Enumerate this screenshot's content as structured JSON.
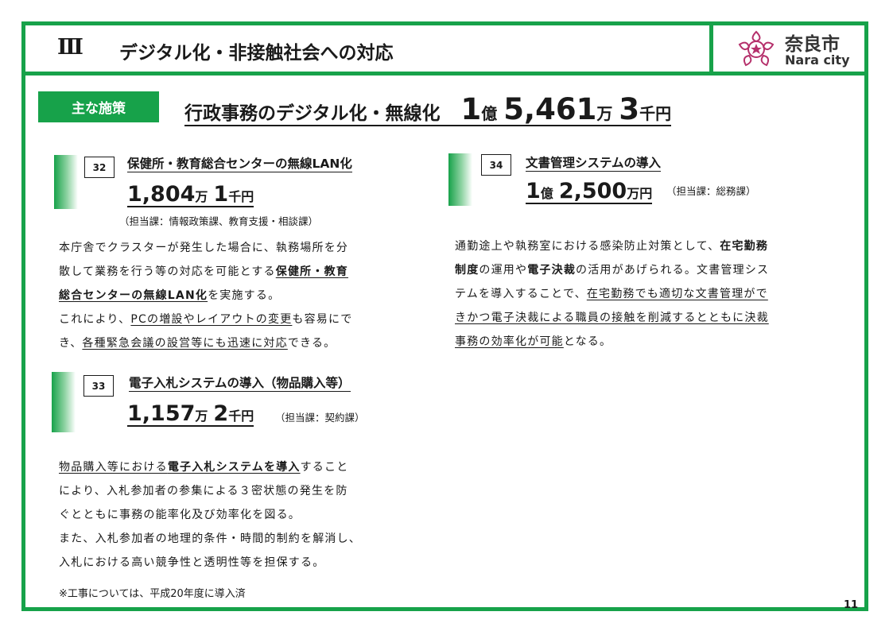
{
  "header": {
    "section_numeral": "Ⅲ",
    "title": "デジタル化・非接触社会への対応",
    "logo_ja": "奈良市",
    "logo_en": "Nara city"
  },
  "tag_label": "主な施策",
  "headline": {
    "text": "行政事務のデジタル化・無線化",
    "a1": "1",
    "u1": "億",
    "a2": "5,461",
    "u2": "万",
    "a3": "3",
    "u3": "千円"
  },
  "items": [
    {
      "number": "32",
      "title": "保健所・教育総合センターの無線LAN化",
      "a1": "1,804",
      "u1": "万",
      "a2": "1",
      "u2": "千円",
      "dept": "（担当課：情報政策課、教育支援・相談課）",
      "lines": [
        [
          {
            "t": "本庁舎でクラスターが発生した場合に、執務場所を分"
          }
        ],
        [
          {
            "t": "散して業務を行う等の対応を可能とする"
          },
          {
            "t": "保健所・教育",
            "s": "bu"
          }
        ],
        [
          {
            "t": "総合センターの無線LAN化",
            "s": "bu"
          },
          {
            "t": "を実施する。"
          }
        ],
        [
          {
            "t": "これにより、"
          },
          {
            "t": "PCの増設やレイアウトの変更",
            "s": "u"
          },
          {
            "t": "も容易にで"
          }
        ],
        [
          {
            "t": "き、"
          },
          {
            "t": "各種緊急会議の設営等にも迅速に対応",
            "s": "u"
          },
          {
            "t": "できる。"
          }
        ]
      ]
    },
    {
      "number": "33",
      "title": "電子入札システムの導入（物品購入等）",
      "a1": "1,157",
      "u1": "万",
      "a2": "2",
      "u2": "千円",
      "dept": "（担当課：契約課）",
      "lines": [
        [
          {
            "t": "物品購入等における",
            "s": "u"
          },
          {
            "t": "電子入札システムを導入",
            "s": "bu"
          },
          {
            "t": "すること"
          }
        ],
        [
          {
            "t": "により、入札参加者の参集による３密状態の発生を防"
          }
        ],
        [
          {
            "t": "ぐとともに事務の能率化及び効率化を図る。"
          }
        ],
        [
          {
            "t": "また、入札参加者の地理的条件・時間的制約を解消し、"
          }
        ],
        [
          {
            "t": "入札における高い競争性と透明性等を担保する。"
          }
        ]
      ],
      "note": "※工事については、平成20年度に導入済"
    },
    {
      "number": "34",
      "title": "文書管理システムの導入",
      "a1": "1",
      "u1": "億",
      "a2": "2,500",
      "u2": "万円",
      "dept": "（担当課：総務課）",
      "lines": [
        [
          {
            "t": "通勤途上や執務室における感染防止対策として、"
          },
          {
            "t": "在宅勤務",
            "s": "b"
          }
        ],
        [
          {
            "t": "制度",
            "s": "b"
          },
          {
            "t": "の運用や"
          },
          {
            "t": "電子決裁",
            "s": "b"
          },
          {
            "t": "の活用があげられる。文書管理シス"
          }
        ],
        [
          {
            "t": "テムを導入することで、"
          },
          {
            "t": "在宅勤務でも適切な文書管理がで",
            "s": "u"
          }
        ],
        [
          {
            "t": "きかつ電子決裁による職員の接触を削減するとともに決裁",
            "s": "u"
          }
        ],
        [
          {
            "t": "事務の効率化が可能",
            "s": "u"
          },
          {
            "t": "となる。"
          }
        ]
      ]
    }
  ],
  "page_number": "11",
  "colors": {
    "accent": "#17a24a",
    "logo": "#b5306b"
  }
}
